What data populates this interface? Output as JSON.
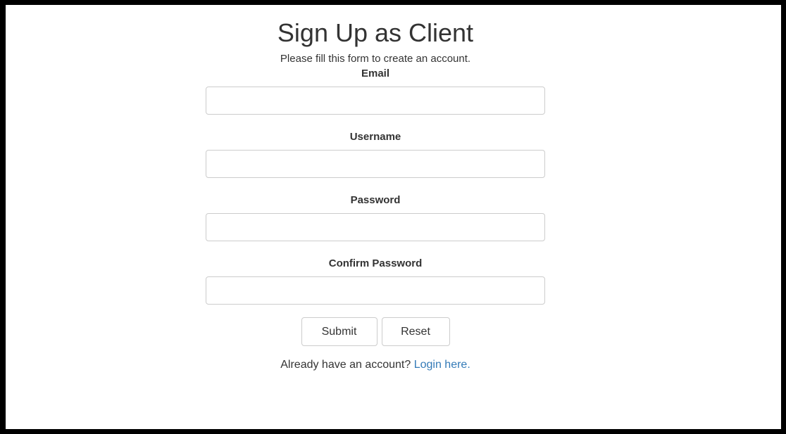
{
  "form": {
    "title": "Sign Up as Client",
    "subtitle": "Please fill this form to create an account.",
    "fields": [
      {
        "label": "Email",
        "value": ""
      },
      {
        "label": "Username",
        "value": ""
      },
      {
        "label": "Password",
        "value": ""
      },
      {
        "label": "Confirm Password",
        "value": ""
      }
    ],
    "submit_label": "Submit",
    "reset_label": "Reset",
    "login_prompt": "Already have an account?",
    "login_link_label": "Login here."
  },
  "colors": {
    "link": "#337ab7",
    "text": "#333333",
    "border": "#cccccc",
    "frame": "#000000"
  }
}
